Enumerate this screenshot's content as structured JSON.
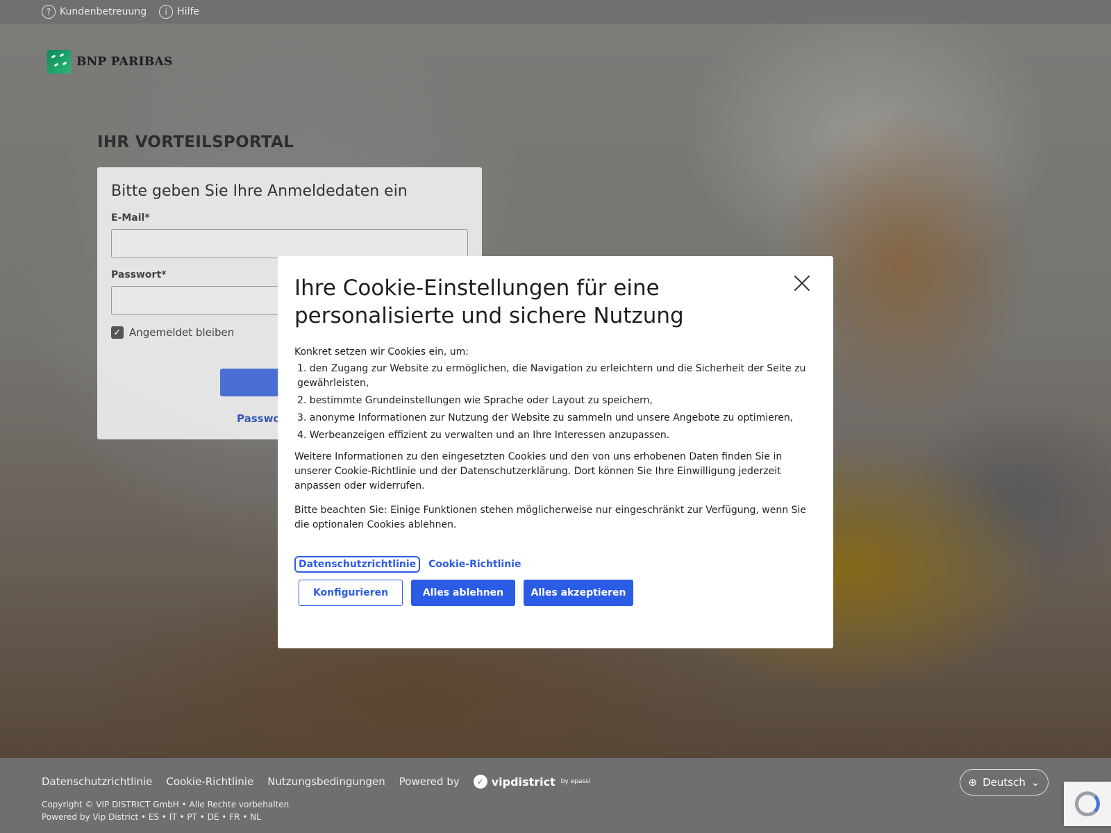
{
  "topbar": {
    "support_label": "Kundenbetreuung",
    "help_label": "Hilfe"
  },
  "logo": {
    "text": "BNP PARIBAS"
  },
  "portal": {
    "title": "IHR VORTEILSPORTAL"
  },
  "login": {
    "heading": "Bitte geben Sie Ihre Anmeldedaten ein",
    "email_label": "E-Mail*",
    "email_value": "",
    "password_label": "Passwort*",
    "password_value": "",
    "remember_label": "Angemeldet bleiben",
    "remember_checked": true,
    "forgot_partial": "Passwor"
  },
  "cookie_modal": {
    "title": "Ihre Cookie-Einstellungen für eine personalisierte und sichere Nutzung",
    "intro": "Konkret setzen wir Cookies ein, um:",
    "items": [
      "1. den Zugang zur Website zu ermöglichen, die Navigation zu erleichtern und die Sicherheit der Seite zu gewährleisten,",
      "2. bestimmte Grundeinstellungen wie Sprache oder Layout zu speichern,",
      "3. anonyme Informationen zur Nutzung der Website zu sammeln und unsere Angebote zu optimieren,",
      "4. Werbeanzeigen effizient zu verwalten und an Ihre Interessen anzupassen."
    ],
    "more_info": "Weitere Informationen zu den eingesetzten Cookies und den von uns erhobenen Daten finden Sie in unserer Cookie-Richtlinie und der Datenschutzerklärung. Dort können Sie Ihre Einwilligung jederzeit anpassen oder widerrufen.",
    "note": "Bitte beachten Sie: Einige Funktionen stehen möglicherweise nur eingeschränkt zur Verfügung, wenn Sie die optionalen Cookies ablehnen.",
    "link_privacy": "Datenschutzrichtlinie",
    "link_cookie": "Cookie-Richtlinie",
    "btn_configure": "Konfigurieren",
    "btn_reject": "Alles ablehnen",
    "btn_accept": "Alles akzeptieren"
  },
  "footer": {
    "links": [
      "Datenschutzrichtlinie",
      "Cookie-Richtlinie",
      "Nutzungsbedingungen"
    ],
    "powered_by": "Powered by",
    "powered_brand": "vipdistrict",
    "powered_brand_suffix": "by epassi",
    "copyright": "Copyright © VIP DISTRICT GmbH • Alle Rechte vorbehalten",
    "powered_line": "Powered by Vip District • ES • IT • PT • DE • FR • NL",
    "language": "Deutsch"
  },
  "colors": {
    "accent": "#2b5ce6",
    "footer_bg": "#6f6f6f",
    "login_button": "#4a6fd4"
  }
}
